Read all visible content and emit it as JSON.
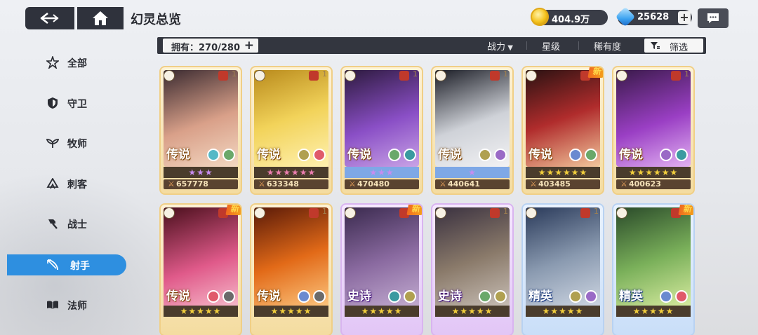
{
  "header": {
    "title": "幻灵总览",
    "gold": "404.9万",
    "gems": "25628"
  },
  "filter_bar": {
    "owned_label": "拥有：270/280",
    "sort_power": "战力",
    "sort_star": "星级",
    "sort_rarity": "稀有度",
    "filter_label": "筛选"
  },
  "sidebar": {
    "items": [
      {
        "label": "全部",
        "icon": "all-icon"
      },
      {
        "label": "守卫",
        "icon": "shield-icon"
      },
      {
        "label": "牧师",
        "icon": "priest-icon"
      },
      {
        "label": "刺客",
        "icon": "assassin-icon"
      },
      {
        "label": "战士",
        "icon": "warrior-icon"
      },
      {
        "label": "射手",
        "icon": "archer-icon"
      },
      {
        "label": "法师",
        "icon": "mage-icon"
      }
    ],
    "active_index": 5
  },
  "cards": [
    {
      "rarity": "传说",
      "stars": "★★★",
      "star_color": "#c78cf0",
      "power": "657778",
      "level": "1",
      "new": false,
      "frame": "gold"
    },
    {
      "rarity": "传说",
      "stars": "★★★★★★",
      "star_color": "#ec7fb0",
      "power": "633348",
      "level": "1",
      "new": false,
      "frame": "gold"
    },
    {
      "rarity": "传说",
      "stars": "★★★",
      "star_color": "#c78cf0",
      "power": "470480",
      "level": "1",
      "new": false,
      "frame": "gold"
    },
    {
      "rarity": "传说",
      "stars": "★",
      "star_color": "#c78cf0",
      "power": "440641",
      "level": "1",
      "new": false,
      "frame": "gold"
    },
    {
      "rarity": "传说",
      "stars": "★★★★★★",
      "star_color": "#f2cf3d",
      "power": "403485",
      "level": "1",
      "new": true,
      "new_label": "新",
      "frame": "gold"
    },
    {
      "rarity": "传说",
      "stars": "★★★★★★",
      "star_color": "#f2cf3d",
      "power": "400623",
      "level": "1",
      "new": false,
      "frame": "gold"
    },
    {
      "rarity": "传说",
      "stars": "★★★★★",
      "star_color": "#f2cf3d",
      "power": "",
      "level": "1",
      "new": true,
      "new_label": "新",
      "frame": "gold"
    },
    {
      "rarity": "传说",
      "stars": "★★★★★",
      "star_color": "#f2cf3d",
      "power": "",
      "level": "1",
      "new": false,
      "frame": "gold"
    },
    {
      "rarity": "史诗",
      "stars": "★★★★★",
      "star_color": "#f2cf3d",
      "power": "",
      "level": "1",
      "new": true,
      "new_label": "新",
      "frame": "purple"
    },
    {
      "rarity": "史诗",
      "stars": "★★★★★",
      "star_color": "#f2cf3d",
      "power": "",
      "level": "1",
      "new": false,
      "frame": "purple"
    },
    {
      "rarity": "精英",
      "stars": "★★★★★",
      "star_color": "#f2cf3d",
      "power": "",
      "level": "1",
      "new": false,
      "frame": "blue"
    },
    {
      "rarity": "精英",
      "stars": "★★★★★",
      "star_color": "#f2cf3d",
      "power": "",
      "level": "1",
      "new": true,
      "new_label": "新",
      "frame": "blue"
    }
  ]
}
